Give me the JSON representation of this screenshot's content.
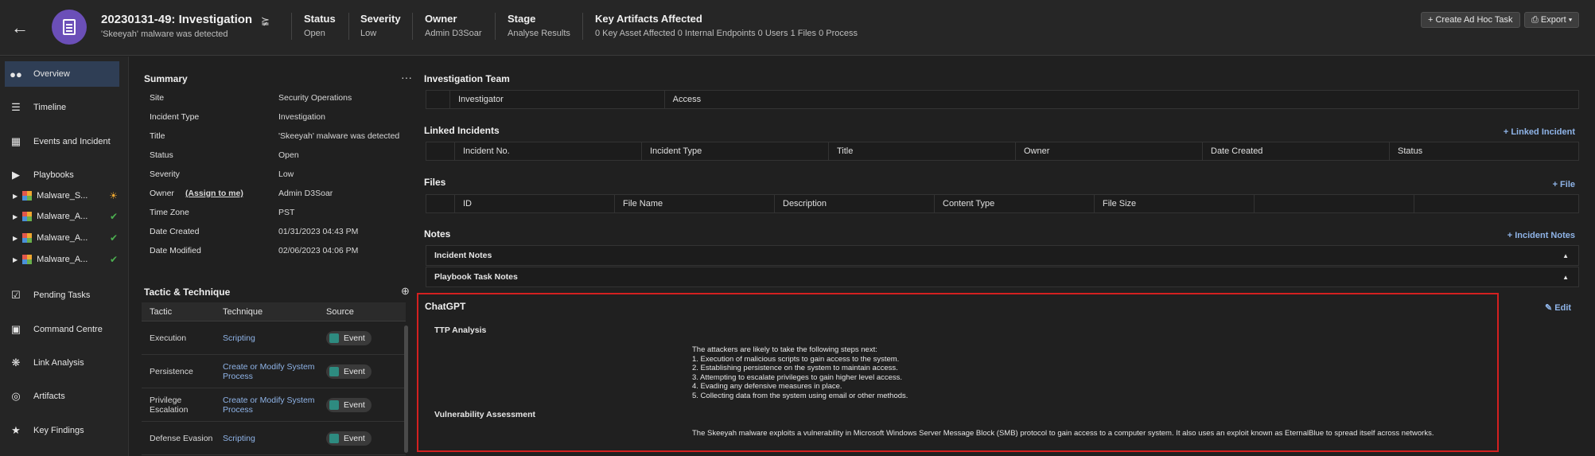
{
  "header": {
    "back_icon": "arrow-left-icon",
    "case_title": "20230131-49: Investigation",
    "case_subtitle": "'Skeeyah' malware was detected",
    "status_label": "Status",
    "status_value": "Open",
    "severity_label": "Severity",
    "severity_value": "Low",
    "owner_label": "Owner",
    "owner_value": "Admin D3Soar",
    "stage_label": "Stage",
    "stage_value": "Analyse Results",
    "artifacts_label": "Key Artifacts Affected",
    "artifacts_value": "0 Key Asset Affected  0 Internal Endpoints  0 Users  1 Files  0 Process",
    "create_task_label": "+ Create Ad Hoc Task",
    "export_label": "Export"
  },
  "sidebar": {
    "overview": "Overview",
    "timeline": "Timeline",
    "events": "Events and Incident",
    "playbooks": "Playbooks",
    "playbook_items": [
      "Malware_S...",
      "Malware_A...",
      "Malware_A...",
      "Malware_A..."
    ],
    "pending": "Pending Tasks",
    "command": "Command Centre",
    "link": "Link Analysis",
    "artifacts": "Artifacts",
    "findings": "Key Findings"
  },
  "summary": {
    "title": "Summary",
    "menu": "···",
    "site_k": "Site",
    "site_v": "Security Operations",
    "type_k": "Incident Type",
    "type_v": "Investigation",
    "title_k": "Title",
    "title_v": "'Skeeyah' malware was detected",
    "status_k": "Status",
    "status_v": "Open",
    "severity_k": "Severity",
    "severity_v": "Low",
    "owner_k": "Owner",
    "assign": "(Assign to me)",
    "owner_v": "Admin D3Soar",
    "tz_k": "Time Zone",
    "tz_v": "PST",
    "created_k": "Date Created",
    "created_v": "01/31/2023 04:43 PM",
    "modified_k": "Date Modified",
    "modified_v": "02/06/2023 04:06 PM"
  },
  "tactic": {
    "title": "Tactic & Technique",
    "h_tactic": "Tactic",
    "h_technique": "Technique",
    "h_source": "Source",
    "rows": [
      {
        "tactic": "Execution",
        "technique": "Scripting",
        "source": "Event"
      },
      {
        "tactic": "Persistence",
        "technique": "Create or Modify System Process",
        "source": "Event"
      },
      {
        "tactic": "Privilege Escalation",
        "technique": "Create or Modify System Process",
        "source": "Event"
      },
      {
        "tactic": "Defense Evasion",
        "technique": "Scripting",
        "source": "Event"
      }
    ]
  },
  "team": {
    "title": "Investigation Team",
    "h_investigator": "Investigator",
    "h_access": "Access"
  },
  "linked": {
    "title": "Linked Incidents",
    "action": "+ Linked Incident",
    "h_no": "Incident No.",
    "h_type": "Incident Type",
    "h_title": "Title",
    "h_owner": "Owner",
    "h_date": "Date Created",
    "h_status": "Status"
  },
  "files": {
    "title": "Files",
    "action": "+ File",
    "h_id": "ID",
    "h_name": "File Name",
    "h_desc": "Description",
    "h_ct": "Content Type",
    "h_size": "File Size"
  },
  "notes": {
    "title": "Notes",
    "action": "+ Incident Notes",
    "incident": "Incident Notes",
    "playbook": "Playbook Task Notes"
  },
  "chatgpt": {
    "title": "ChatGPT",
    "edit": "Edit",
    "ttp_title": "TTP Analysis",
    "ttp_text": "The attackers are likely to take the following steps next:\n1. Execution of malicious scripts to gain access to the system.\n2. Establishing persistence on the system to maintain access.\n3. Attempting to escalate privileges to gain higher level access.\n4. Evading any defensive measures in place.\n5. Collecting data from the system using email or other methods.",
    "vuln_title": "Vulnerability Assessment",
    "vuln_text": "The Skeeyah malware exploits a vulnerability in Microsoft Windows Server Message Block (SMB) protocol to gain access to a computer system. It also uses an exploit known as EternalBlue to spread itself across networks."
  },
  "colors": {
    "accent": "#6b4fb8",
    "link": "#8fb4e8",
    "highlight": "#d32020",
    "success": "#4caf50",
    "warning": "#f0a830"
  }
}
